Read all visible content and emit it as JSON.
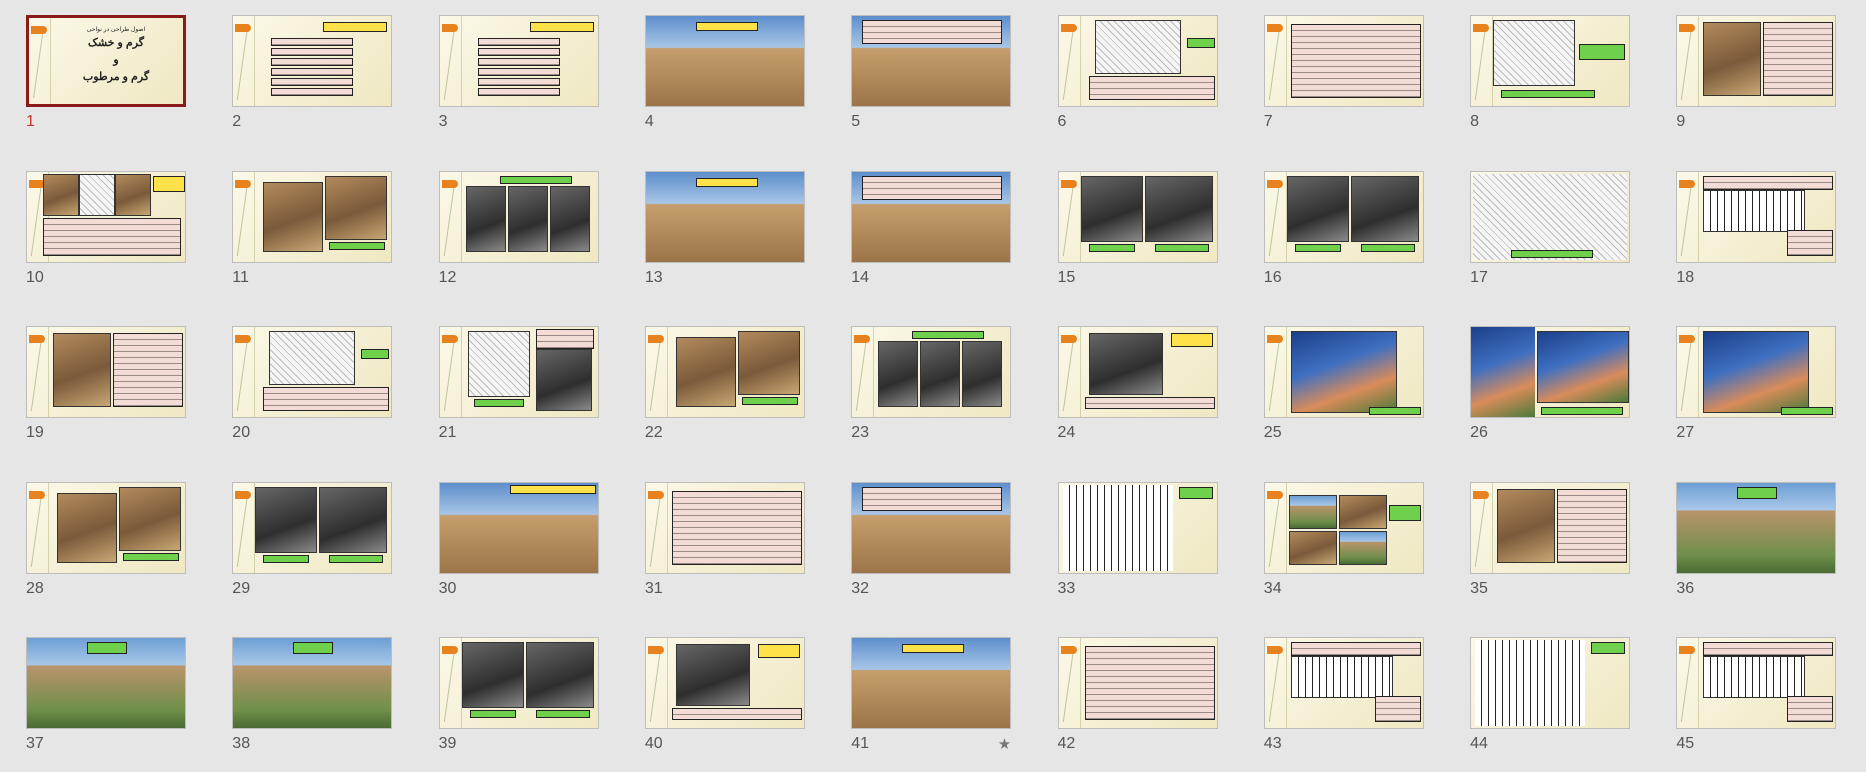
{
  "view": "slide-sorter",
  "selected_slide": 1,
  "colors": {
    "selection_border": "#8b1a1a",
    "selected_number": "#c0392b",
    "accent_tab": "#e8821e",
    "label_green": "#6fd14b",
    "label_yellow": "#ffe14a"
  },
  "title_slide": {
    "subtitle": "اصول طراحی در نواحی",
    "line1": "گرم و خشک",
    "line2": "و",
    "line3": "گرم و مرطوب"
  },
  "slides": [
    {
      "number": "1",
      "kind": "title"
    },
    {
      "number": "2",
      "kind": "list"
    },
    {
      "number": "3",
      "kind": "list"
    },
    {
      "number": "4",
      "kind": "photo-sky"
    },
    {
      "number": "5",
      "kind": "photo-sky-text"
    },
    {
      "number": "6",
      "kind": "sketch-text"
    },
    {
      "number": "7",
      "kind": "text"
    },
    {
      "number": "8",
      "kind": "sketch-label"
    },
    {
      "number": "9",
      "kind": "photo-text"
    },
    {
      "number": "10",
      "kind": "photos-list"
    },
    {
      "number": "11",
      "kind": "photo-pair"
    },
    {
      "number": "12",
      "kind": "photo-triple"
    },
    {
      "number": "13",
      "kind": "photo-sky"
    },
    {
      "number": "14",
      "kind": "photo-sky-text"
    },
    {
      "number": "15",
      "kind": "photo-pair-dark"
    },
    {
      "number": "16",
      "kind": "photo-pair-dark"
    },
    {
      "number": "17",
      "kind": "sketch-wide"
    },
    {
      "number": "18",
      "kind": "plan-text"
    },
    {
      "number": "19",
      "kind": "photo-text"
    },
    {
      "number": "20",
      "kind": "sketch-text"
    },
    {
      "number": "21",
      "kind": "sketch-photo"
    },
    {
      "number": "22",
      "kind": "photo-pair"
    },
    {
      "number": "23",
      "kind": "photo-triple"
    },
    {
      "number": "24",
      "kind": "photo-label"
    },
    {
      "number": "25",
      "kind": "photo-blue"
    },
    {
      "number": "26",
      "kind": "photo-blue-pair"
    },
    {
      "number": "27",
      "kind": "photo-blue"
    },
    {
      "number": "28",
      "kind": "photo-pair"
    },
    {
      "number": "29",
      "kind": "photo-pair-dark"
    },
    {
      "number": "30",
      "kind": "photo-full"
    },
    {
      "number": "31",
      "kind": "text"
    },
    {
      "number": "32",
      "kind": "photo-sky-text"
    },
    {
      "number": "33",
      "kind": "plan"
    },
    {
      "number": "34",
      "kind": "photo-grid"
    },
    {
      "number": "35",
      "kind": "photo-text"
    },
    {
      "number": "36",
      "kind": "photo-green"
    },
    {
      "number": "37",
      "kind": "photo-green"
    },
    {
      "number": "38",
      "kind": "photo-green"
    },
    {
      "number": "39",
      "kind": "photo-pair-dark"
    },
    {
      "number": "40",
      "kind": "photo-label"
    },
    {
      "number": "41",
      "kind": "photo-sky",
      "starred": true
    },
    {
      "number": "42",
      "kind": "text"
    },
    {
      "number": "43",
      "kind": "plan-text"
    },
    {
      "number": "44",
      "kind": "plan"
    },
    {
      "number": "45",
      "kind": "plan-text"
    }
  ],
  "star_glyph": "★"
}
